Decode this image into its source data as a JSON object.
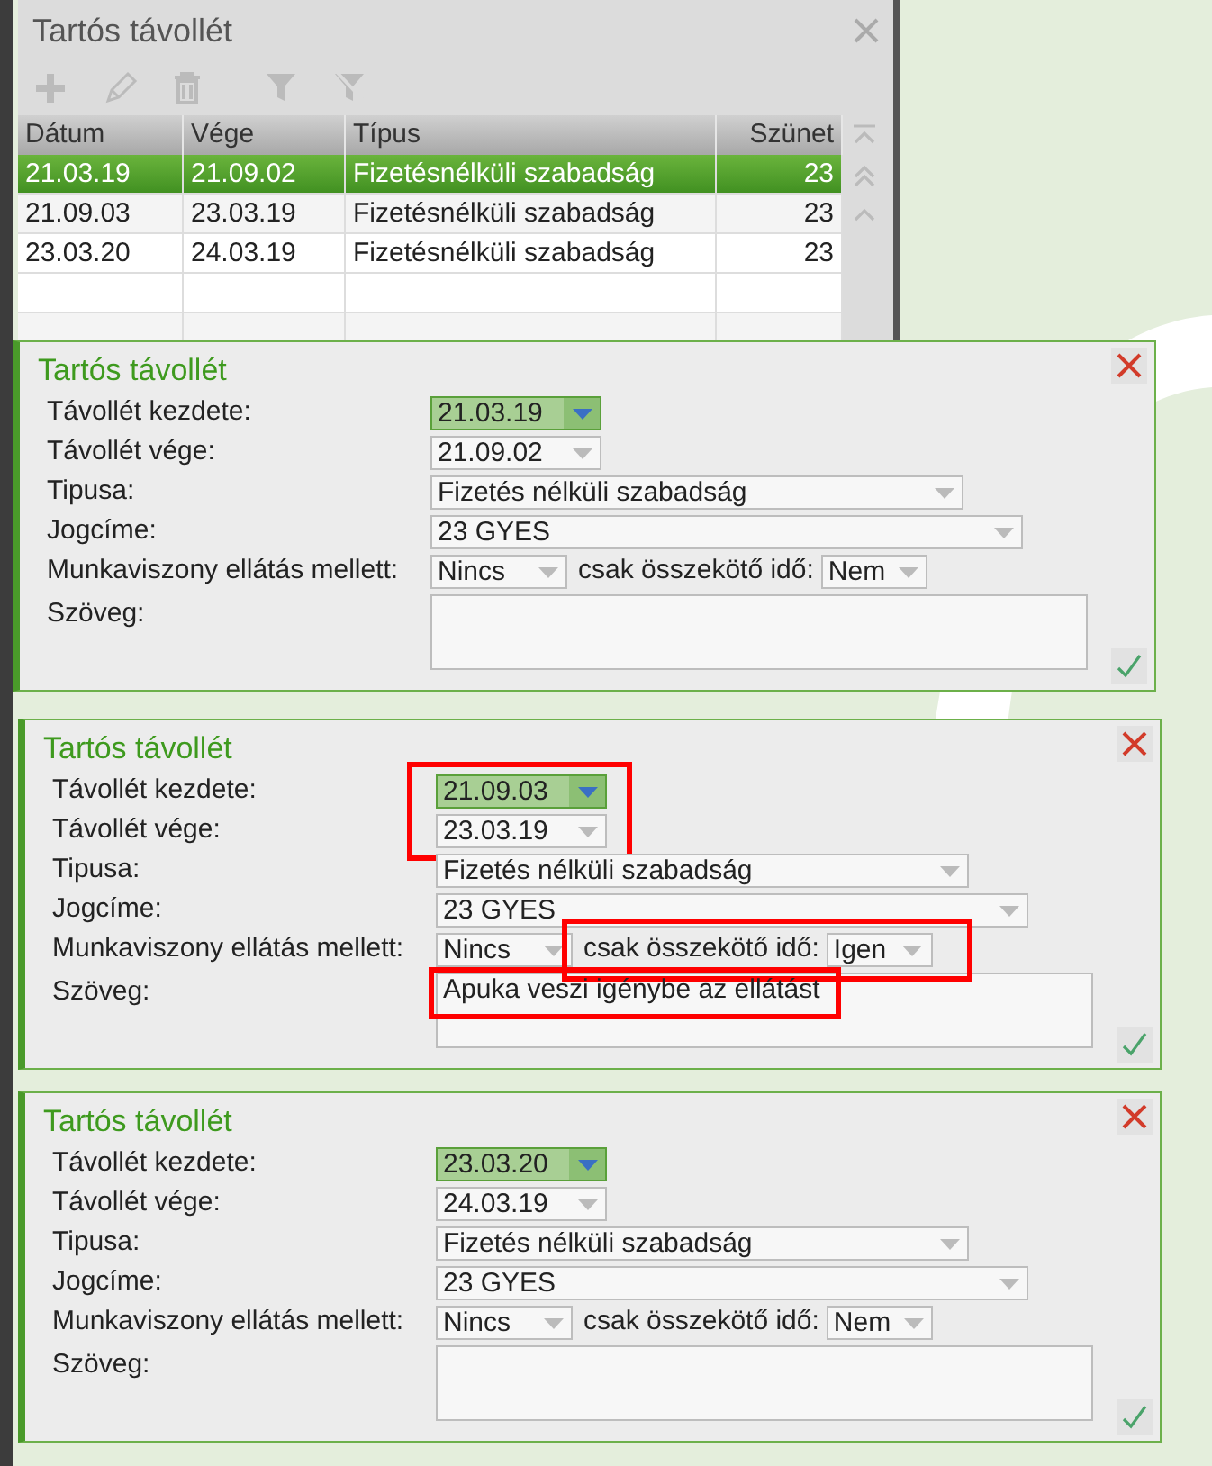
{
  "list_panel": {
    "title": "Tartós távollét",
    "toolbar": [
      {
        "kind": "add",
        "disabled": true
      },
      {
        "kind": "edit",
        "disabled": true
      },
      {
        "kind": "delete",
        "disabled": true
      },
      {
        "kind": "filter",
        "disabled": true
      },
      {
        "kind": "clear_filter",
        "disabled": true
      }
    ],
    "table": {
      "columns": [
        "Dátum",
        "Vége",
        "Típus",
        "Szünet"
      ],
      "rows": [
        {
          "selected": true,
          "cells": [
            "21.03.19",
            "21.09.02",
            "Fizetésnélküli szabadság",
            "23"
          ]
        },
        {
          "selected": false,
          "cells": [
            "21.09.03",
            "23.03.19",
            "Fizetésnélküli szabadság",
            "23"
          ]
        },
        {
          "selected": false,
          "cells": [
            "23.03.20",
            "24.03.19",
            "Fizetésnélküli szabadság",
            "23"
          ]
        }
      ]
    }
  },
  "forms": [
    {
      "title": "Tartós távollét",
      "labels": [
        "Távollét kezdete:",
        "Távollét vége:",
        "Tipusa:",
        "Jogcíme:",
        "Munkaviszony ellátás mellett:",
        "csak összekötő idő:",
        "Szöveg:"
      ],
      "start": "21.03.19",
      "end": "21.09.02",
      "type": "Fizetés nélküli szabadság",
      "legal_title": "23 GYES",
      "employment": "Nincs",
      "link_time": "Nem",
      "dates_highlighted": false,
      "link_highlighted": false
    },
    {
      "title": "Tartós távollét",
      "labels": [
        "Távollét kezdete:",
        "Távollét vége:",
        "Tipusa:",
        "Jogcíme:",
        "Munkaviszony ellátás mellett:",
        "csak összekötő idő:",
        "Szöveg:"
      ],
      "start": "21.09.03",
      "end": "23.03.19",
      "type": "Fizetés nélküli szabadság",
      "legal_title": "23 GYES",
      "employment": "Nincs",
      "link_time": "Igen",
      "text": "Apuka veszi igénybe az ellátást",
      "dates_highlighted": true,
      "link_highlighted": true,
      "text_highlighted": true
    },
    {
      "title": "Tartós távollét",
      "labels": [
        "Távollét kezdete:",
        "Távollét vége:",
        "Tipusa:",
        "Jogcíme:",
        "Munkaviszony ellátás mellett:",
        "csak összekötő idő:",
        "Szöveg:"
      ],
      "start": "23.03.20",
      "end": "24.03.19",
      "type": "Fizetés nélküli szabadság",
      "legal_title": "23 GYES",
      "employment": "Nincs",
      "link_time": "Nem",
      "dates_highlighted": false,
      "link_highlighted": false
    }
  ]
}
